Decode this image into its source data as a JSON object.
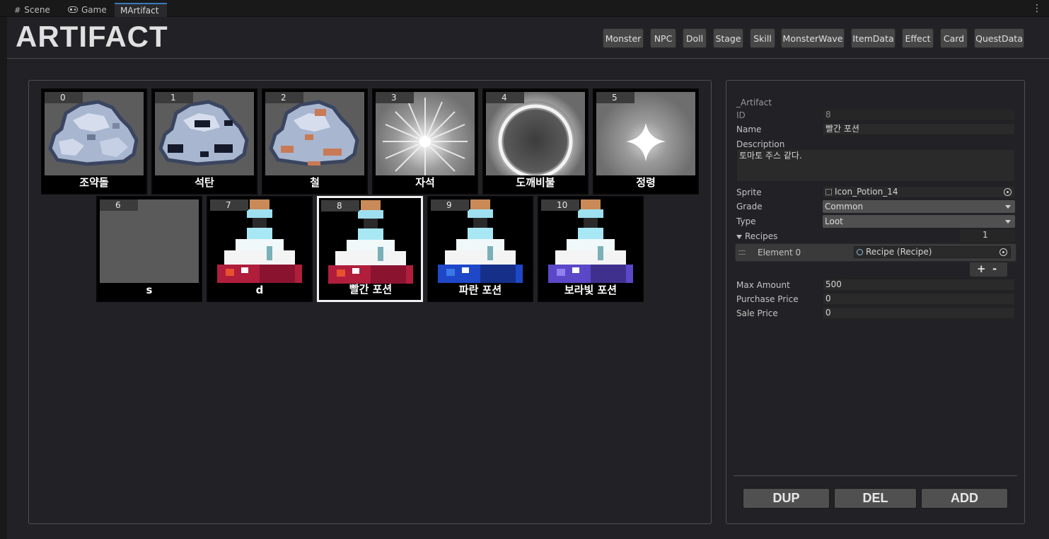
{
  "tabs": [
    {
      "label": "Scene",
      "icon": "grid-icon"
    },
    {
      "label": "Game",
      "icon": "gamepad-icon"
    },
    {
      "label": "MArtifact",
      "icon": ""
    }
  ],
  "title": "ARTIFACT",
  "nav_buttons": [
    "Monster",
    "NPC",
    "Doll",
    "Stage",
    "Skill",
    "MonsterWave",
    "ItemData",
    "Effect",
    "Card",
    "QuestData"
  ],
  "items": [
    {
      "id": "0",
      "name": "조약돌",
      "icon": "pebble-rock-icon"
    },
    {
      "id": "1",
      "name": "석탄",
      "icon": "coal-rock-icon"
    },
    {
      "id": "2",
      "name": "철",
      "icon": "iron-ore-icon"
    },
    {
      "id": "3",
      "name": "자석",
      "icon": "starburst-icon"
    },
    {
      "id": "4",
      "name": "도깨비불",
      "icon": "glowing-ring-icon"
    },
    {
      "id": "5",
      "name": "정령",
      "icon": "sparkle-star-icon"
    },
    {
      "id": "6",
      "name": "s",
      "icon": ""
    },
    {
      "id": "7",
      "name": "d",
      "icon": "red-potion-icon"
    },
    {
      "id": "8",
      "name": "빨간 포션",
      "icon": "red-potion-icon"
    },
    {
      "id": "9",
      "name": "파란 포션",
      "icon": "blue-potion-icon"
    },
    {
      "id": "10",
      "name": "보라빛 포션",
      "icon": "purple-potion-icon"
    }
  ],
  "selected_index": 8,
  "inspector": {
    "header": "_Artifact",
    "id_label": "ID",
    "id_value": "8",
    "name_label": "Name",
    "name_value": "빨간 포션",
    "desc_label": "Description",
    "desc_value": "토마토 주스 같다.",
    "sprite_label": "Sprite",
    "sprite_value": "Icon_Potion_14",
    "grade_label": "Grade",
    "grade_value": "Common",
    "type_label": "Type",
    "type_value": "Loot",
    "recipes_label": "Recipes",
    "recipes_count": "1",
    "element_label": "Element 0",
    "element_value": "Recipe (Recipe)",
    "plus": "+",
    "minus": "-",
    "max_amount_label": "Max Amount",
    "max_amount_value": "500",
    "purchase_label": "Purchase Price",
    "purchase_value": "0",
    "sale_label": "Sale Price",
    "sale_value": "0"
  },
  "actions": {
    "dup": "DUP",
    "del": "DEL",
    "add": "ADD"
  }
}
